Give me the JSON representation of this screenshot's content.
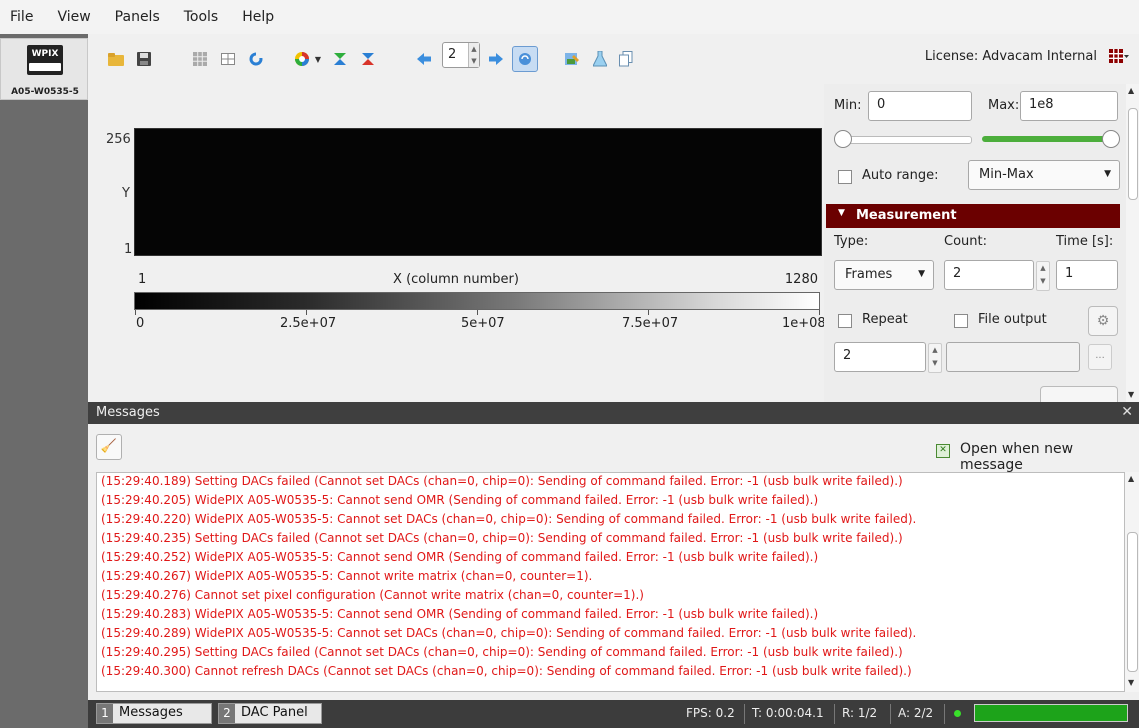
{
  "menu": [
    "File",
    "View",
    "Panels",
    "Tools",
    "Help"
  ],
  "device": {
    "chip_label": "WPIX",
    "name": "A05-W0535-5"
  },
  "toolbar": {
    "frame_index": "2",
    "license": "License: Advacam Internal",
    "icons": [
      "open-folder-icon",
      "save-icon",
      "grid-icon",
      "layout-icon",
      "refresh-icon",
      "color-palette-icon",
      "filter-icon",
      "mask-icon",
      "arrow-left-icon",
      "arrow-right-icon",
      "sync-icon",
      "image-edit-icon",
      "flask-icon",
      "copy-icon"
    ]
  },
  "plot": {
    "y_max": "256",
    "y_label": "Y",
    "y_min": "1",
    "x_min": "1",
    "x_label": "X (column number)",
    "x_max": "1280",
    "colorbar_ticks": [
      "0",
      "2.5e+07",
      "5e+07",
      "7.5e+07",
      "1e+08"
    ]
  },
  "settings": {
    "min_label": "Min:",
    "min_value": "0",
    "max_label": "Max:",
    "max_value": "1e8",
    "min_slider_pct": 0,
    "max_slider_pct": 100,
    "auto_range_label": "Auto range:",
    "auto_range_checked": false,
    "range_mode": "Min-Max",
    "measurement_title": "Measurement",
    "type_label": "Type:",
    "count_label": "Count:",
    "time_label": "Time [s]:",
    "type_value": "Frames",
    "count_value": "2",
    "time_value": "1",
    "repeat_label": "Repeat",
    "repeat_checked": false,
    "file_output_label": "File output",
    "file_output_checked": false,
    "repeat_count": "2",
    "file_path": "",
    "dots_label": "..."
  },
  "messages": {
    "title": "Messages",
    "open_when_new_label": "Open when new message",
    "open_when_new_checked": true,
    "lines": [
      "(15:29:40.189) Setting DACs failed (Cannot set DACs (chan=0, chip=0): Sending of command failed. Error: -1 (usb bulk write failed).)",
      "(15:29:40.205) WidePIX A05-W0535-5: Cannot send OMR (Sending of command failed. Error: -1 (usb bulk write failed).)",
      "(15:29:40.220) WidePIX A05-W0535-5: Cannot set DACs (chan=0, chip=0): Sending of command failed. Error: -1 (usb bulk write failed).",
      "(15:29:40.235) Setting DACs failed (Cannot set DACs (chan=0, chip=0): Sending of command failed. Error: -1 (usb bulk write failed).)",
      "(15:29:40.252) WidePIX A05-W0535-5: Cannot send OMR (Sending of command failed. Error: -1 (usb bulk write failed).)",
      "(15:29:40.267) WidePIX A05-W0535-5: Cannot write matrix (chan=0, counter=1).",
      "(15:29:40.276) Cannot set pixel configuration (Cannot write matrix (chan=0, counter=1).)",
      "(15:29:40.283) WidePIX A05-W0535-5: Cannot send OMR (Sending of command failed. Error: -1 (usb bulk write failed).)",
      "(15:29:40.289) WidePIX A05-W0535-5: Cannot set DACs (chan=0, chip=0): Sending of command failed. Error: -1 (usb bulk write failed).",
      "(15:29:40.295) Setting DACs failed (Cannot set DACs (chan=0, chip=0): Sending of command failed. Error: -1 (usb bulk write failed).)",
      "(15:29:40.300) Cannot refresh DACs (Cannot set DACs (chan=0, chip=0): Sending of command failed. Error: -1 (usb bulk write failed).)"
    ],
    "error_color": "#e01818"
  },
  "statusbar": {
    "tabs": [
      {
        "num": "1",
        "label": "Messages"
      },
      {
        "num": "2",
        "label": "DAC Panel"
      }
    ],
    "fps": "FPS: 0.2",
    "time": "T: 0:00:04.1",
    "r": "R: 1/2",
    "a": "A: 2/2",
    "progress_pct": 100,
    "progress_color": "#1da31a"
  }
}
